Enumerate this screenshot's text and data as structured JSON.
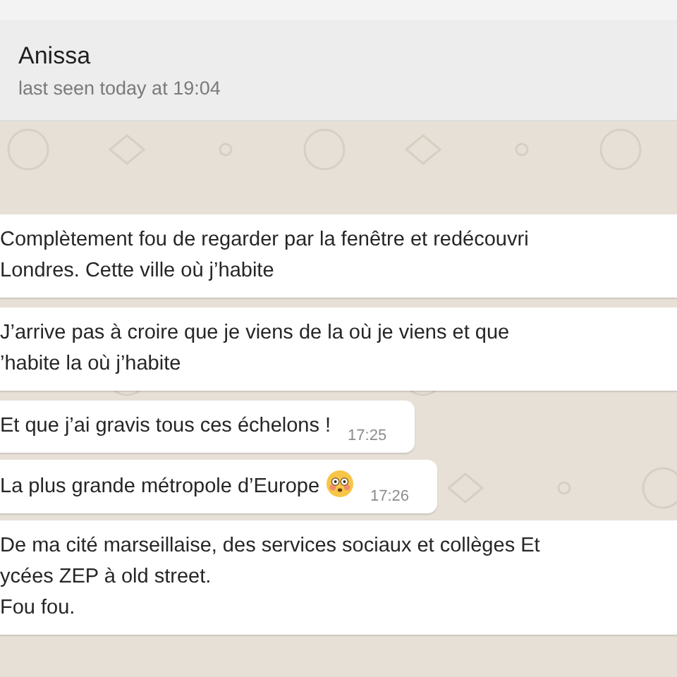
{
  "contact": {
    "name": "Anissa",
    "status": "last seen today at 19:04"
  },
  "messages": [
    {
      "text": "Complètement fou de regarder par la fenêtre et redécouvri\nLondres. Cette ville où j’habite",
      "cut_right": true
    },
    {
      "text": "J’arrive pas à croire que je viens de la où je viens et que\n’habite la où j’habite",
      "cut_right": true
    },
    {
      "text": "Et que j’ai gravis tous ces échelons !",
      "time": "17:25",
      "cut_right": false
    },
    {
      "text": "La plus grande métropole d’Europe",
      "emoji": true,
      "time": "17:26",
      "cut_right": false
    },
    {
      "text": "De ma cité marseillaise, des services sociaux et collèges Et\nycées ZEP à old street.\nFou fou.",
      "cut_right": true
    }
  ]
}
